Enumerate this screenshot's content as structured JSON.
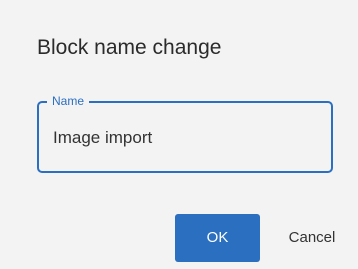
{
  "dialog": {
    "title": "Block name change"
  },
  "name_field": {
    "label": "Name",
    "value": "Image import"
  },
  "actions": {
    "ok_label": "OK",
    "cancel_label": "Cancel"
  },
  "colors": {
    "accent": "#2a6fc0",
    "background": "#f3f3f3",
    "text": "#333333"
  }
}
